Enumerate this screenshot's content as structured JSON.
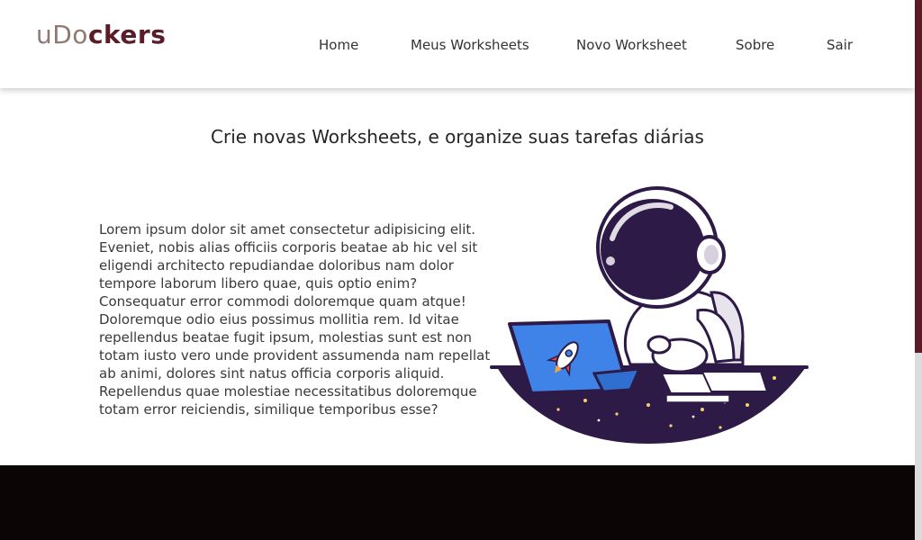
{
  "header": {
    "logo": {
      "part1": "uDo",
      "part2": "ckers"
    },
    "nav": [
      "Home",
      "Meus Worksheets",
      "Novo Worksheet",
      "Sobre",
      "Sair"
    ]
  },
  "hero": {
    "subtitle": "Crie novas Worksheets, e organize suas tarefas diárias",
    "body": "Lorem ipsum dolor sit amet consectetur adipisicing elit. Eveniet, nobis alias officiis corporis beatae ab hic vel sit eligendi architecto repudiandae doloribus nam dolor tempore laborum libero quae, quis optio enim? Consequatur error commodi doloremque quam atque! Doloremque odio eius possimus mollitia rem. Id vitae repellendus beatae fugit ipsum, molestias sunt est non totam iusto vero unde provident assumenda nam repellat ab animi, dolores sint natus officia corporis aliquid. Repellendus quae molestiae necessitatibus doloremque totam error reiciendis, similique temporibus esse?",
    "illustration": "astronaut-laptop-illustration"
  },
  "colors": {
    "brand_dark": "#5a1c28",
    "brand_light": "#8f7a72",
    "footer": "#0b0505",
    "illustration_purple": "#2e1a47",
    "laptop_blue": "#3f82e8"
  }
}
